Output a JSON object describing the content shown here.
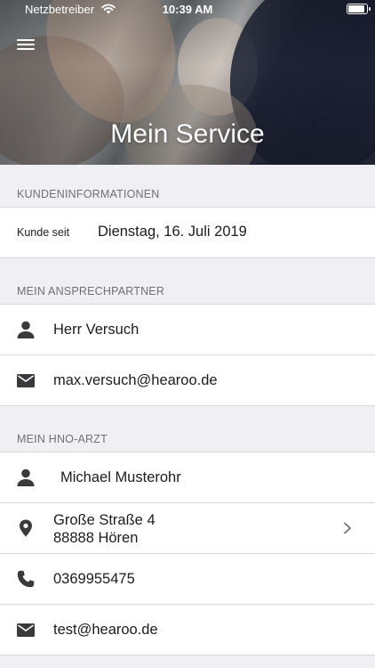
{
  "status_bar": {
    "carrier": "Netzbetreiber",
    "time": "10:39 AM",
    "battery_level": 1.0
  },
  "header": {
    "title": "Mein Service"
  },
  "sections": {
    "customer": {
      "title": "KUNDENINFORMATIONEN",
      "since_label": "Kunde seit",
      "since_value": "Dienstag, 16. Juli 2019"
    },
    "contact": {
      "title": "MEIN ANSPRECHPARTNER",
      "name": "Herr Versuch",
      "email": "max.versuch@hearoo.de"
    },
    "doctor": {
      "title": "MEIN HNO-ARZT",
      "name": "Michael Musterohr",
      "street": "Große Straße 4",
      "city": "88888 Hören",
      "phone": "0369955475",
      "email": "test@hearoo.de"
    }
  },
  "icons": {
    "menu": "hamburger-menu-icon",
    "person": "person-icon",
    "email": "envelope-icon",
    "location": "map-pin-icon",
    "phone": "phone-icon",
    "chevron": "chevron-right-icon"
  },
  "colors": {
    "background": "#efeff4",
    "icon": "#3a3a3c",
    "section_text": "#707075"
  }
}
